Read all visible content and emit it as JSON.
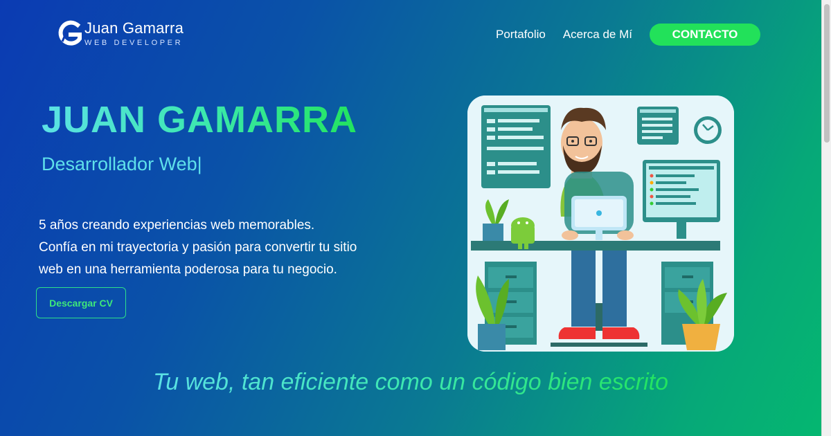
{
  "logo": {
    "name": "Juan Gamarra",
    "subtitle": "WEB DEVELOPER",
    "icon": "g-logo-icon"
  },
  "nav": {
    "portfolio": "Portafolio",
    "about": "Acerca de Mí",
    "contact": "CONTACTO"
  },
  "hero": {
    "title": "JUAN GAMARRA",
    "subtitle": "Desarrollador Web|",
    "desc_line1": "5 años creando experiencias web memorables.",
    "desc_line2": "Confía en mi trayectoria y pasión para convertir tu sitio",
    "desc_line3": "web en una herramienta poderosa para tu negocio.",
    "cv_button": "Descargar CV"
  },
  "tagline": "Tu web, tan eficiente como un código bien escrito",
  "colors": {
    "accent_green": "#22e15a",
    "accent_cyan": "#5fe0ea"
  }
}
